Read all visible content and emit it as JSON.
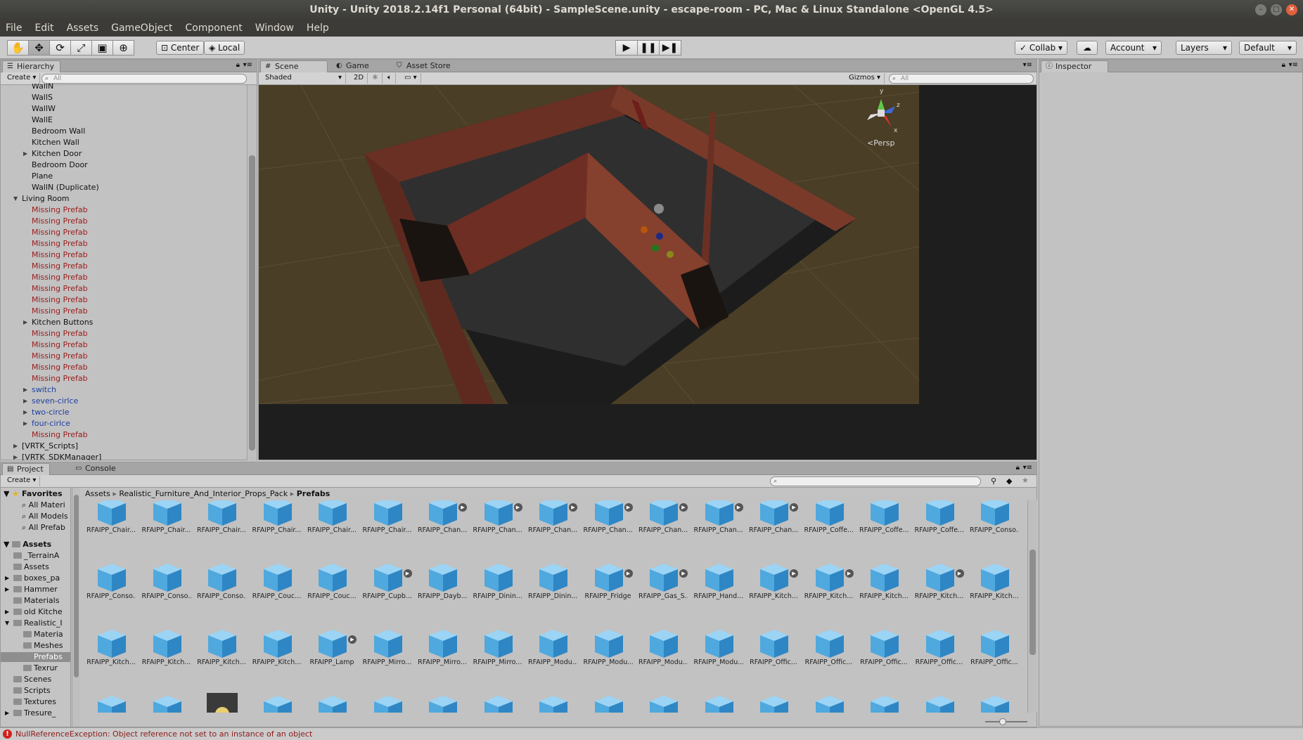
{
  "window": {
    "title": "Unity - Unity 2018.2.14f1 Personal (64bit) - SampleScene.unity - escape-room - PC, Mac & Linux Standalone <OpenGL 4.5>"
  },
  "menu": [
    "File",
    "Edit",
    "Assets",
    "GameObject",
    "Component",
    "Window",
    "Help"
  ],
  "toolbar": {
    "pivot": "Center",
    "space": "Local",
    "collab": "Collab",
    "account": "Account",
    "layers": "Layers",
    "layout": "Default"
  },
  "hierarchy": {
    "tab": "Hierarchy",
    "create": "Create",
    "search_placeholder": "All",
    "rows": [
      {
        "label": "WallN",
        "type": "normal",
        "indent": 2,
        "arrow": ""
      },
      {
        "label": "WallS",
        "type": "normal",
        "indent": 2,
        "arrow": ""
      },
      {
        "label": "WallW",
        "type": "normal",
        "indent": 2,
        "arrow": ""
      },
      {
        "label": "WallE",
        "type": "normal",
        "indent": 2,
        "arrow": ""
      },
      {
        "label": "Bedroom Wall",
        "type": "normal",
        "indent": 2,
        "arrow": ""
      },
      {
        "label": "Kitchen Wall",
        "type": "normal",
        "indent": 2,
        "arrow": ""
      },
      {
        "label": "Kitchen Door",
        "type": "normal",
        "indent": 2,
        "arrow": "▶"
      },
      {
        "label": "Bedroom Door",
        "type": "normal",
        "indent": 2,
        "arrow": ""
      },
      {
        "label": "Plane",
        "type": "normal",
        "indent": 2,
        "arrow": ""
      },
      {
        "label": "WallN (Duplicate)",
        "type": "normal",
        "indent": 2,
        "arrow": ""
      },
      {
        "label": "Living Room",
        "type": "normal",
        "indent": 1,
        "arrow": "▼"
      },
      {
        "label": "Missing Prefab",
        "type": "missing",
        "indent": 2,
        "arrow": ""
      },
      {
        "label": "Missing Prefab",
        "type": "missing",
        "indent": 2,
        "arrow": ""
      },
      {
        "label": "Missing Prefab",
        "type": "missing",
        "indent": 2,
        "arrow": ""
      },
      {
        "label": "Missing Prefab",
        "type": "missing",
        "indent": 2,
        "arrow": ""
      },
      {
        "label": "Missing Prefab",
        "type": "missing",
        "indent": 2,
        "arrow": ""
      },
      {
        "label": "Missing Prefab",
        "type": "missing",
        "indent": 2,
        "arrow": ""
      },
      {
        "label": "Missing Prefab",
        "type": "missing",
        "indent": 2,
        "arrow": ""
      },
      {
        "label": "Missing Prefab",
        "type": "missing",
        "indent": 2,
        "arrow": ""
      },
      {
        "label": "Missing Prefab",
        "type": "missing",
        "indent": 2,
        "arrow": ""
      },
      {
        "label": "Missing Prefab",
        "type": "missing",
        "indent": 2,
        "arrow": ""
      },
      {
        "label": "Kitchen Buttons",
        "type": "normal",
        "indent": 2,
        "arrow": "▶"
      },
      {
        "label": "Missing Prefab",
        "type": "missing",
        "indent": 2,
        "arrow": ""
      },
      {
        "label": "Missing Prefab",
        "type": "missing",
        "indent": 2,
        "arrow": ""
      },
      {
        "label": "Missing Prefab",
        "type": "missing",
        "indent": 2,
        "arrow": ""
      },
      {
        "label": "Missing Prefab",
        "type": "missing",
        "indent": 2,
        "arrow": ""
      },
      {
        "label": "Missing Prefab",
        "type": "missing",
        "indent": 2,
        "arrow": ""
      },
      {
        "label": "switch",
        "type": "prefab",
        "indent": 2,
        "arrow": "▶"
      },
      {
        "label": "seven-cirlce",
        "type": "prefab",
        "indent": 2,
        "arrow": "▶"
      },
      {
        "label": "two-circle",
        "type": "prefab",
        "indent": 2,
        "arrow": "▶"
      },
      {
        "label": "four-cirlce",
        "type": "prefab",
        "indent": 2,
        "arrow": "▶"
      },
      {
        "label": "Missing Prefab",
        "type": "missing",
        "indent": 2,
        "arrow": ""
      },
      {
        "label": "[VRTK_Scripts]",
        "type": "normal",
        "indent": 1,
        "arrow": "▶"
      },
      {
        "label": "[VRTK_SDKManager]",
        "type": "normal",
        "indent": 1,
        "arrow": "▶"
      }
    ]
  },
  "scene": {
    "tabs": [
      "Scene",
      "Game",
      "Asset Store"
    ],
    "shading": "Shaded",
    "mode_2d": "2D",
    "gizmos": "Gizmos",
    "search_placeholder": "All",
    "persp_label": "Persp",
    "axis_y": "y",
    "axis_z": "z",
    "axis_x": "x"
  },
  "inspector": {
    "tab": "Inspector"
  },
  "project": {
    "tabs": [
      "Project",
      "Console"
    ],
    "create": "Create",
    "breadcrumb": [
      "Assets",
      "Realistic_Furniture_And_Interior_Props_Pack",
      "Prefabs"
    ],
    "favorites_title": "Favorites",
    "favorites": [
      "All Materi",
      "All Models",
      "All Prefab"
    ],
    "assets_title": "Assets",
    "folders": [
      {
        "label": "_TerrainA",
        "indent": 1,
        "arrow": ""
      },
      {
        "label": "Assets",
        "indent": 1,
        "arrow": ""
      },
      {
        "label": "boxes_pa",
        "indent": 1,
        "arrow": "▶"
      },
      {
        "label": "Hammer",
        "indent": 1,
        "arrow": "▶"
      },
      {
        "label": "Materials",
        "indent": 1,
        "arrow": ""
      },
      {
        "label": "old Kitche",
        "indent": 1,
        "arrow": "▶"
      },
      {
        "label": "Realistic_I",
        "indent": 1,
        "arrow": "▼"
      },
      {
        "label": "Materia",
        "indent": 2,
        "arrow": ""
      },
      {
        "label": "Meshes",
        "indent": 2,
        "arrow": ""
      },
      {
        "label": "Prefabs",
        "indent": 2,
        "arrow": "",
        "selected": true
      },
      {
        "label": "Texrur",
        "indent": 2,
        "arrow": ""
      },
      {
        "label": "Scenes",
        "indent": 1,
        "arrow": ""
      },
      {
        "label": "Scripts",
        "indent": 1,
        "arrow": ""
      },
      {
        "label": "Textures",
        "indent": 1,
        "arrow": ""
      },
      {
        "label": "Tresure_",
        "indent": 1,
        "arrow": "▶"
      }
    ],
    "assets_rows": [
      [
        {
          "label": "RFAIPP_Chair...",
          "play": false
        },
        {
          "label": "RFAIPP_Chair...",
          "play": false
        },
        {
          "label": "RFAIPP_Chair...",
          "play": false
        },
        {
          "label": "RFAIPP_Chair...",
          "play": false
        },
        {
          "label": "RFAIPP_Chair...",
          "play": false
        },
        {
          "label": "RFAIPP_Chair...",
          "play": false
        },
        {
          "label": "RFAIPP_Chan...",
          "play": true
        },
        {
          "label": "RFAIPP_Chan...",
          "play": true
        },
        {
          "label": "RFAIPP_Chan...",
          "play": true
        },
        {
          "label": "RFAIPP_Chan...",
          "play": true
        },
        {
          "label": "RFAIPP_Chan...",
          "play": true
        },
        {
          "label": "RFAIPP_Chan...",
          "play": true
        },
        {
          "label": "RFAIPP_Chan...",
          "play": true
        },
        {
          "label": "RFAIPP_Coffe...",
          "play": false
        },
        {
          "label": "RFAIPP_Coffe...",
          "play": false
        },
        {
          "label": "RFAIPP_Coffe...",
          "play": false
        },
        {
          "label": "RFAIPP_Conso...",
          "play": false
        }
      ],
      [
        {
          "label": "RFAIPP_Conso...",
          "play": false
        },
        {
          "label": "RFAIPP_Conso...",
          "play": false
        },
        {
          "label": "RFAIPP_Conso...",
          "play": false
        },
        {
          "label": "RFAIPP_Couc...",
          "play": false
        },
        {
          "label": "RFAIPP_Couc...",
          "play": false
        },
        {
          "label": "RFAIPP_Cupb...",
          "play": true
        },
        {
          "label": "RFAIPP_Dayb...",
          "play": false
        },
        {
          "label": "RFAIPP_Dinin...",
          "play": false
        },
        {
          "label": "RFAIPP_Dinin...",
          "play": false
        },
        {
          "label": "RFAIPP_Fridge",
          "play": true
        },
        {
          "label": "RFAIPP_Gas_S...",
          "play": true
        },
        {
          "label": "RFAIPP_Hand...",
          "play": false
        },
        {
          "label": "RFAIPP_Kitch...",
          "play": true
        },
        {
          "label": "RFAIPP_Kitch...",
          "play": true
        },
        {
          "label": "RFAIPP_Kitch...",
          "play": false
        },
        {
          "label": "RFAIPP_Kitch...",
          "play": true
        },
        {
          "label": "RFAIPP_Kitch...",
          "play": false
        }
      ],
      [
        {
          "label": "RFAIPP_Kitch...",
          "play": false
        },
        {
          "label": "RFAIPP_Kitch...",
          "play": false
        },
        {
          "label": "RFAIPP_Kitch...",
          "play": false
        },
        {
          "label": "RFAIPP_Kitch...",
          "play": false
        },
        {
          "label": "RFAIPP_Lamp",
          "play": true
        },
        {
          "label": "RFAIPP_Mirro...",
          "play": false
        },
        {
          "label": "RFAIPP_Mirro...",
          "play": false
        },
        {
          "label": "RFAIPP_Mirro...",
          "play": false
        },
        {
          "label": "RFAIPP_Modu...",
          "play": false
        },
        {
          "label": "RFAIPP_Modu...",
          "play": false
        },
        {
          "label": "RFAIPP_Modu...",
          "play": false
        },
        {
          "label": "RFAIPP_Modu...",
          "play": false
        },
        {
          "label": "RFAIPP_Offic...",
          "play": false
        },
        {
          "label": "RFAIPP_Offic...",
          "play": false
        },
        {
          "label": "RFAIPP_Offic...",
          "play": false
        },
        {
          "label": "RFAIPP_Offic...",
          "play": false
        },
        {
          "label": "RFAIPP_Offic...",
          "play": false
        }
      ]
    ],
    "zoom_level": 0.4
  },
  "status": {
    "message": "NullReferenceException: Object reference not set to an instance of an object"
  },
  "colors": {
    "missing": "#9c1b1b",
    "prefab": "#1f3fa0",
    "error": "#d31f1f",
    "cube": "#5ab4ea"
  }
}
